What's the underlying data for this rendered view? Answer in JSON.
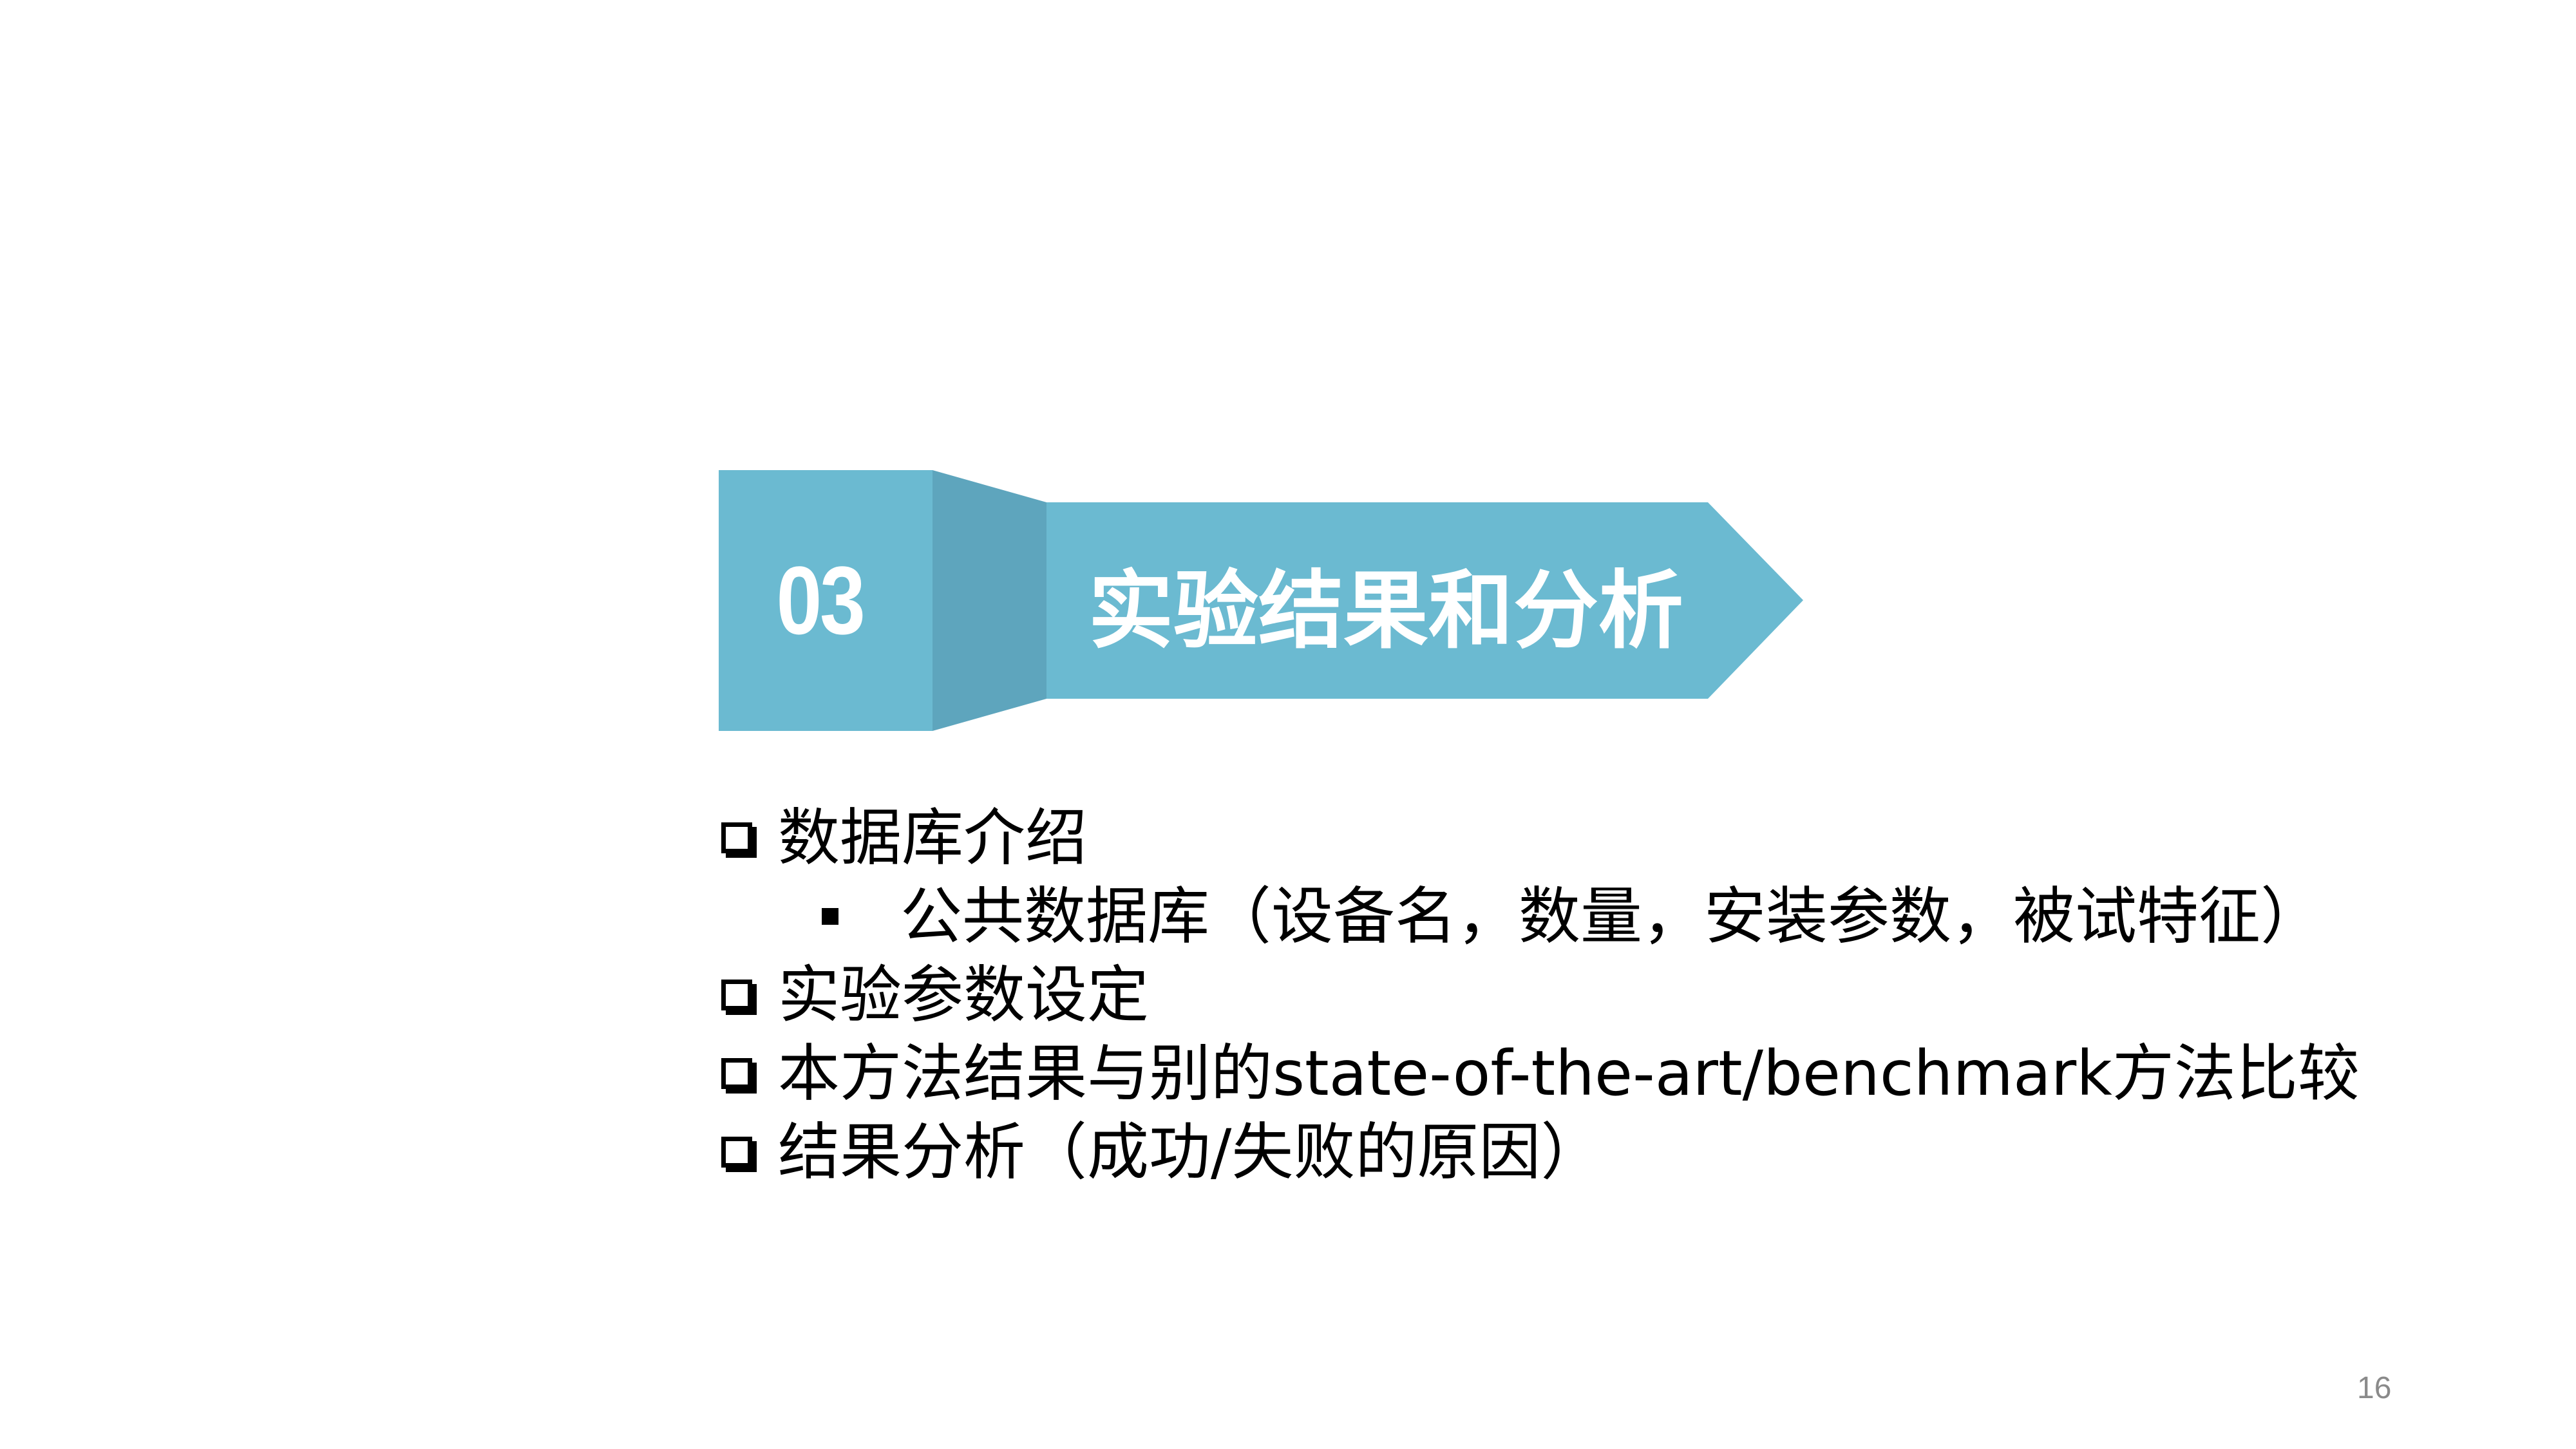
{
  "section": {
    "number": "03",
    "title": "实验结果和分析"
  },
  "colors": {
    "banner_light": "#6bbad1",
    "banner_dark": "#5ea5bd",
    "text": "#000000",
    "page_number": "#8a8a8a"
  },
  "outline": {
    "items": [
      {
        "text": "数据库介绍",
        "bullet": "checkbox-icon",
        "level": 1
      },
      {
        "text": "公共数据库（设备名，数量，安装参数，被试特征）",
        "bullet": "square-bullet-icon",
        "level": 2
      },
      {
        "text": "实验参数设定",
        "bullet": "checkbox-icon",
        "level": 1
      },
      {
        "text": "本方法结果与别的state-of-the-art/benchmark方法比较",
        "bullet": "checkbox-icon",
        "level": 1
      },
      {
        "text": "结果分析（成功/失败的原因）",
        "bullet": "checkbox-icon",
        "level": 1
      }
    ]
  },
  "page_number": "16"
}
